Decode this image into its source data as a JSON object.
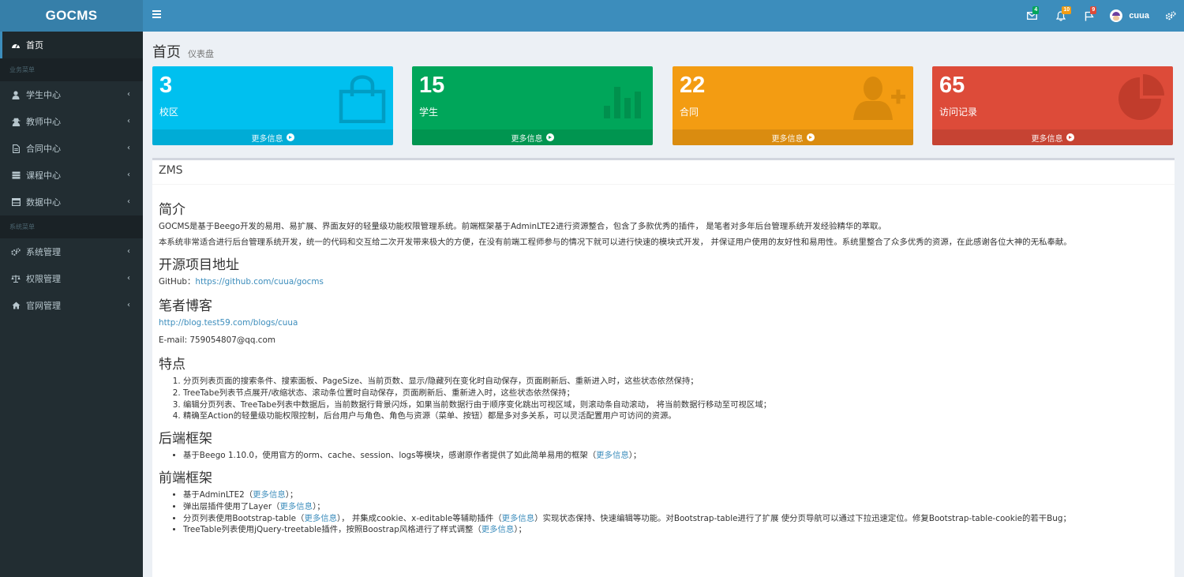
{
  "app": {
    "logo": "GOCMS"
  },
  "header": {
    "notifications": [
      {
        "name": "mail",
        "count": "4",
        "color": "#00a65a"
      },
      {
        "name": "bell",
        "count": "10",
        "color": "#f39c12"
      },
      {
        "name": "flag",
        "count": "9",
        "color": "#dd4b39"
      }
    ],
    "user": "cuua"
  },
  "sidebar": {
    "home": "首页",
    "header1": "业务菜单",
    "items1": [
      {
        "label": "学生中心",
        "icon": "user-icon"
      },
      {
        "label": "教师中心",
        "icon": "user-secret-icon"
      },
      {
        "label": "合同中心",
        "icon": "file-icon"
      },
      {
        "label": "课程中心",
        "icon": "server-icon"
      },
      {
        "label": "数据中心",
        "icon": "table-icon"
      }
    ],
    "header2": "系统菜单",
    "items2": [
      {
        "label": "系统管理",
        "icon": "gears-icon"
      },
      {
        "label": "权限管理",
        "icon": "balance-icon"
      },
      {
        "label": "官网管理",
        "icon": "home-icon"
      }
    ]
  },
  "page": {
    "title": "首页",
    "subtitle": "仪表盘"
  },
  "boxes": [
    {
      "value": "3",
      "label": "校区",
      "more": "更多信息",
      "color": "#00c0ef",
      "icon": "shopping-bag-icon"
    },
    {
      "value": "15",
      "label": "学生",
      "more": "更多信息",
      "color": "#00a65a",
      "icon": "bar-chart-icon"
    },
    {
      "value": "22",
      "label": "合同",
      "more": "更多信息",
      "color": "#f39c12",
      "icon": "user-plus-icon"
    },
    {
      "value": "65",
      "label": "访问记录",
      "more": "更多信息",
      "color": "#dd4b39",
      "icon": "pie-chart-icon"
    }
  ],
  "panel": {
    "title": "ZMS",
    "intro": {
      "heading": "简介",
      "p1": "GOCMS是基于Beego开发的易用、易扩展、界面友好的轻量级功能权限管理系统。前端框架基于AdminLTE2进行资源整合，包含了多款优秀的插件， 是笔者对多年后台管理系统开发经验精华的萃取。",
      "p2": "本系统非常适合进行后台管理系统开发，统一的代码和交互给二次开发带来极大的方便，在没有前端工程师参与的情况下就可以进行快速的模块式开发， 并保证用户使用的友好性和易用性。系统里整合了众多优秀的资源，在此感谢各位大神的无私奉献。"
    },
    "repo": {
      "heading": "开源项目地址",
      "prefix": "GitHub：",
      "link": "https://github.com/cuua/gocms"
    },
    "blog": {
      "heading": "笔者博客",
      "link": "http://blog.test59.com/blogs/cuua",
      "email": "E-mail: 759054807@qq.com"
    },
    "features": {
      "heading": "特点",
      "items": [
        "分页列表页面的搜索条件、搜索面板、PageSize、当前页数、显示/隐藏列在变化时自动保存，页面刷新后、重新进入时，这些状态依然保持；",
        "TreeTabe列表节点展开/收缩状态、滚动条位置时自动保存，页面刷新后、重新进入时，这些状态依然保持；",
        "编辑分页列表、TreeTabe列表中数据后，当前数据行背景闪烁，如果当前数据行由于顺序变化跳出可视区域，则滚动条自动滚动， 将当前数据行移动至可视区域；",
        "精确至Action的轻量级功能权限控制，后台用户与角色、角色与资源（菜单、按钮）都是多对多关系，可以灵活配置用户可访问的资源。"
      ]
    },
    "backend": {
      "heading": "后端框架",
      "item_pre": "基于Beego 1.10.0，使用官方的orm、cache、session、logs等模块，感谢原作者提供了如此简单易用的框架（",
      "item_link": "更多信息",
      "item_post": "）；"
    },
    "frontend": {
      "heading": "前端框架",
      "items": [
        {
          "pre": "基于AdminLTE2（",
          "link": "更多信息",
          "post": "）；"
        },
        {
          "pre": "弹出层插件使用了Layer（",
          "link": "更多信息",
          "post": "）；"
        },
        {
          "pre": "分页列表使用Bootstrap-table（",
          "link": "更多信息",
          "post": "）， 并集成cookie、x-editable等辅助插件（"
        },
        {
          "pre": "TreeTable列表使用jQuery-treetable插件，按照Boostrap风格进行了样式调整（",
          "link": "更多信息",
          "post": "）；"
        }
      ],
      "item3_link2": "更多信息",
      "item3_tail": "）实现状态保持、快速编辑等功能。对Bootstrap-table进行了扩展 使分页导航可以通过下拉迅速定位。修复Bootstrap-table-cookie的若干Bug；"
    }
  }
}
